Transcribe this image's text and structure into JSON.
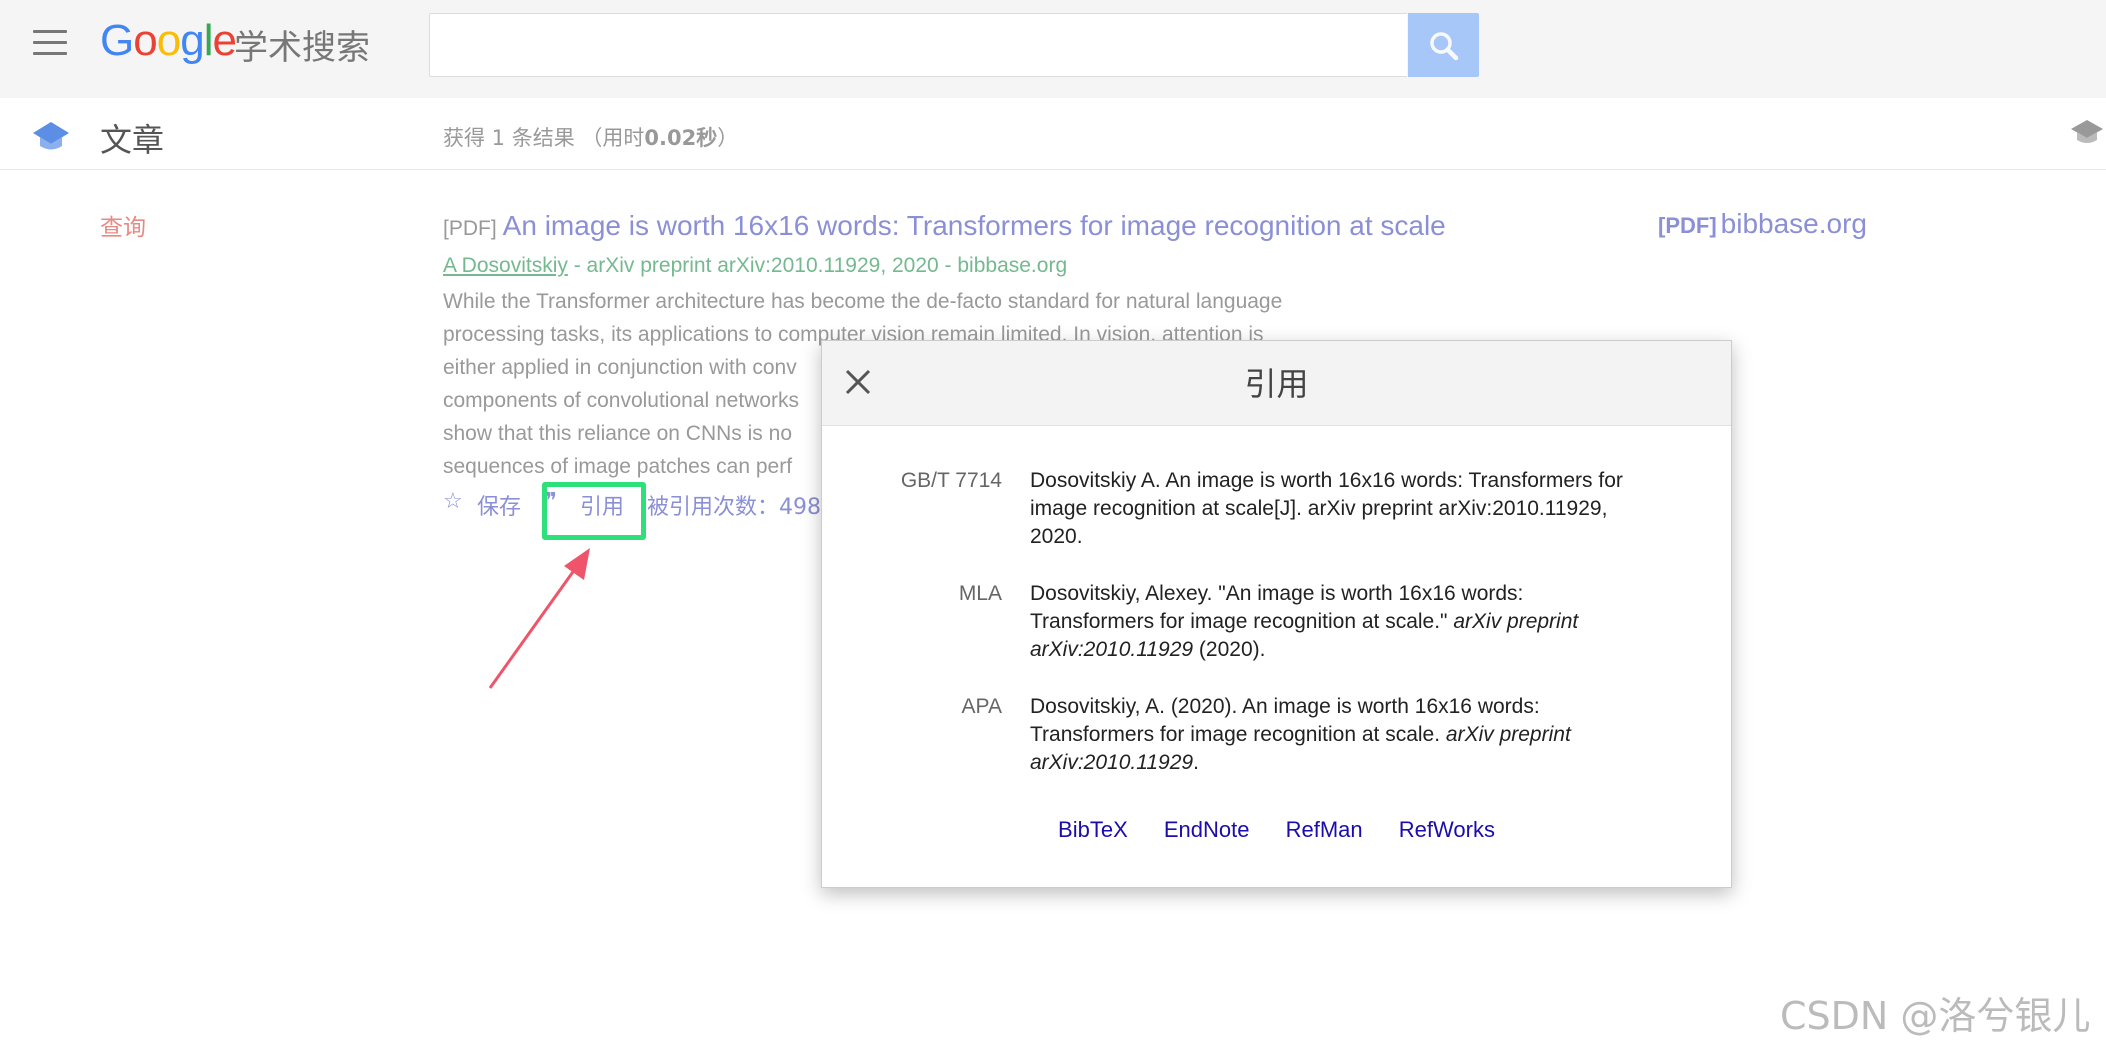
{
  "header": {
    "logo": "Google",
    "logo_sub": "学术搜索",
    "search_placeholder": ""
  },
  "subbar": {
    "title": "文章",
    "result_count_prefix": "获得 1 条结果 （用时",
    "result_time": "0.02秒",
    "result_count_suffix": "）"
  },
  "sidebar": {
    "query_label": "查询"
  },
  "result": {
    "tag": "[PDF]",
    "title": "An image is worth 16x16 words: Transformers for image recognition at scale",
    "author": "A Dosovitskiy",
    "meta_rest": " - arXiv preprint arXiv:2010.11929, 2020 - bibbase.org",
    "snippet_lines": [
      "While the Transformer architecture has become the de-facto standard for natural language",
      "processing tasks, its applications to computer vision remain limited. In vision, attention is",
      "either applied in conjunction with conv",
      "components of convolutional networks",
      "show that this reliance on CNNs is no",
      "sequences of image patches can perf"
    ],
    "save_label": "保存",
    "cite_label": "引用",
    "cited_by": "被引用次数：498"
  },
  "side_link": {
    "tag": "[PDF]",
    "domain": "bibbase.org"
  },
  "modal": {
    "title": "引用",
    "citations": [
      {
        "label": "GB/T 7714",
        "text": "Dosovitskiy A. An image is worth 16x16 words: Transformers for image recognition at scale[J]. arXiv preprint arXiv:2010.11929, 2020."
      },
      {
        "label": "MLA",
        "text_before": "Dosovitskiy, Alexey. \"An image is worth 16x16 words: Transformers for image recognition at scale.\" ",
        "text_italic": "arXiv preprint arXiv:2010.11929",
        "text_after": " (2020)."
      },
      {
        "label": "APA",
        "text_before": "Dosovitskiy, A. (2020). An image is worth 16x16 words: Transformers for image recognition at scale. ",
        "text_italic": "arXiv preprint arXiv:2010.11929",
        "text_after": "."
      }
    ],
    "formats": [
      "BibTeX",
      "EndNote",
      "RefMan",
      "RefWorks"
    ]
  },
  "watermark": "CSDN @洛兮银儿",
  "colors": {
    "highlight": "#2ee07a",
    "arrow": "#f0546a",
    "link": "#1a0dab"
  }
}
